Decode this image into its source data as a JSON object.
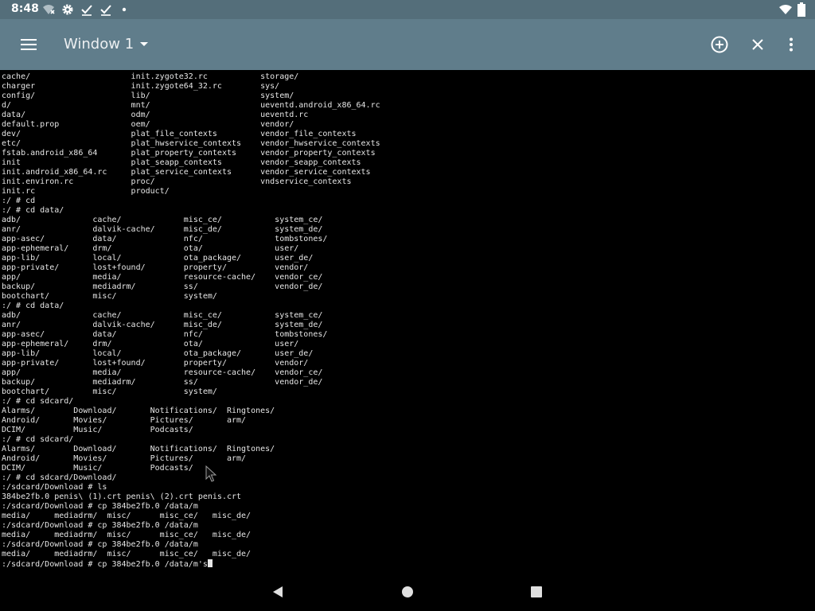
{
  "status_bar": {
    "time": "8:48",
    "icons": [
      "wifi-off-icon",
      "settings-gear-icon",
      "checkmark-icon",
      "checkmark-icon",
      "dot-icon"
    ],
    "right_icons": [
      "wifi-icon",
      "battery-icon"
    ]
  },
  "app_bar": {
    "title": "Window 1",
    "icons": [
      "menu-icon",
      "dropdown-arrow-icon",
      "add-circle-icon",
      "close-icon",
      "more-vert-icon"
    ]
  },
  "terminal": {
    "lines": [
      "cache/                     init.zygote32.rc           storage/",
      "charger                    init.zygote64_32.rc        sys/",
      "config/                    lib/                       system/",
      "d/                         mnt/                       ueventd.android_x86_64.rc",
      "data/                      odm/                       ueventd.rc",
      "default.prop               oem/                       vendor/",
      "dev/                       plat_file_contexts         vendor_file_contexts",
      "etc/                       plat_hwservice_contexts    vendor_hwservice_contexts",
      "fstab.android_x86_64       plat_property_contexts     vendor_property_contexts",
      "init                       plat_seapp_contexts        vendor_seapp_contexts",
      "init.android_x86_64.rc     plat_service_contexts      vendor_service_contexts",
      "init.environ.rc            proc/                      vndservice_contexts",
      "init.rc                    product/",
      ":/ # cd",
      ":/ # cd data/",
      "adb/               cache/             misc_ce/           system_ce/",
      "anr/               dalvik-cache/      misc_de/           system_de/",
      "app-asec/          data/              nfc/               tombstones/",
      "app-ephemeral/     drm/               ota/               user/",
      "app-lib/           local/             ota_package/       user_de/",
      "app-private/       lost+found/        property/          vendor/",
      "app/               media/             resource-cache/    vendor_ce/",
      "backup/            mediadrm/          ss/                vendor_de/",
      "bootchart/         misc/              system/",
      ":/ # cd data/",
      "adb/               cache/             misc_ce/           system_ce/",
      "anr/               dalvik-cache/      misc_de/           system_de/",
      "app-asec/          data/              nfc/               tombstones/",
      "app-ephemeral/     drm/               ota/               user/",
      "app-lib/           local/             ota_package/       user_de/",
      "app-private/       lost+found/        property/          vendor/",
      "app/               media/             resource-cache/    vendor_ce/",
      "backup/            mediadrm/          ss/                vendor_de/",
      "bootchart/         misc/              system/",
      ":/ # cd sdcard/",
      "Alarms/        Download/       Notifications/  Ringtones/",
      "Android/       Movies/         Pictures/       arm/",
      "DCIM/          Music/          Podcasts/",
      ":/ # cd sdcard/",
      "Alarms/        Download/       Notifications/  Ringtones/",
      "Android/       Movies/         Pictures/       arm/",
      "DCIM/          Music/          Podcasts/",
      ":/ # cd sdcard/Download/",
      ":/sdcard/Download # ls",
      "384be2fb.0 penis\\ (1).crt penis\\ (2).crt penis.crt",
      ":/sdcard/Download # cp 384be2fb.0 /data/m",
      "media/     mediadrm/  misc/      misc_ce/   misc_de/",
      ":/sdcard/Download # cp 384be2fb.0 /data/m",
      "media/     mediadrm/  misc/      misc_ce/   misc_de/",
      ":/sdcard/Download # cp 384be2fb.0 /data/m",
      "media/     mediadrm/  misc/      misc_ce/   misc_de/"
    ],
    "input_line": ":/sdcard/Download # cp 384be2fb.0 /data/m's"
  },
  "nav_bar": {
    "icons": [
      "back-icon",
      "home-icon",
      "recents-icon"
    ]
  },
  "colors": {
    "status_bar_bg": "#546e7a",
    "app_bar_bg": "#607d8b",
    "terminal_bg": "#000000",
    "terminal_fg": "#e6e6e6"
  }
}
